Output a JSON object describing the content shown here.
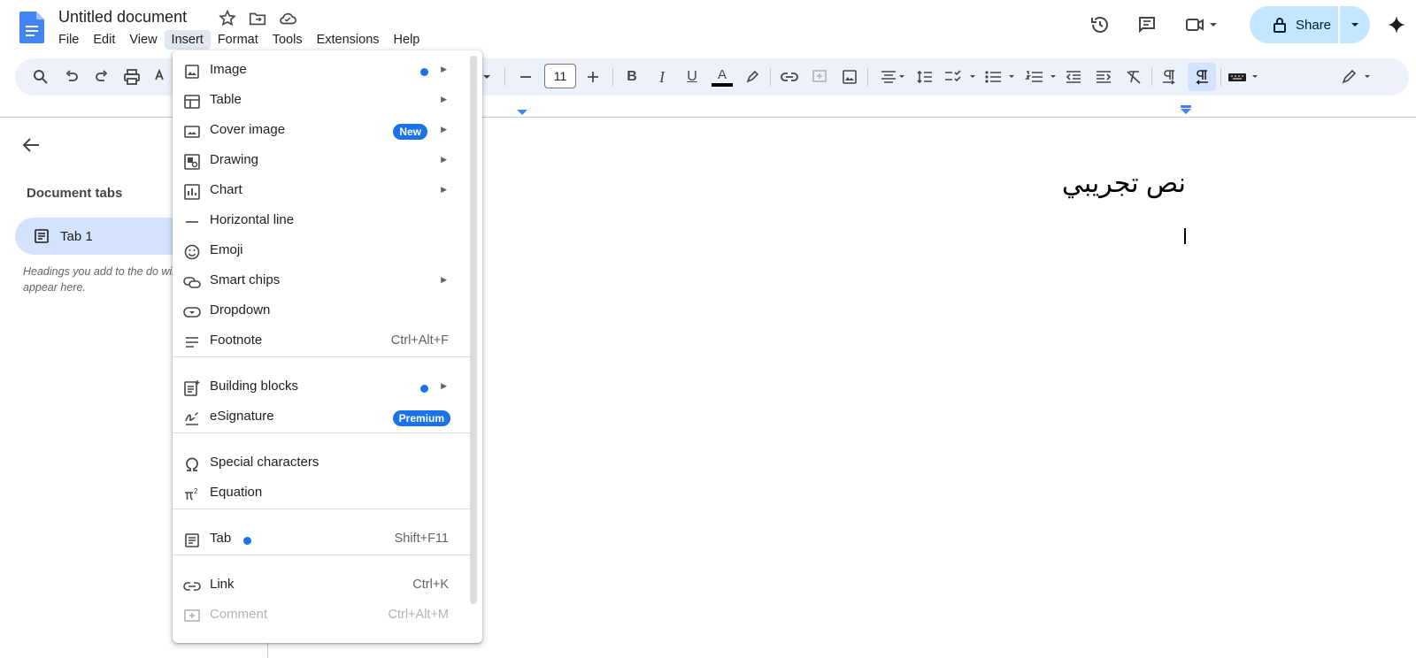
{
  "header": {
    "title": "Untitled document",
    "menus": [
      "File",
      "Edit",
      "View",
      "Insert",
      "Format",
      "Tools",
      "Extensions",
      "Help"
    ],
    "active_menu": "Insert",
    "share_label": "Share"
  },
  "toolbar": {
    "font_size": "11"
  },
  "sidebar": {
    "title": "Document tabs",
    "tab_label": "Tab 1",
    "hint": "Headings you add to the do will appear here."
  },
  "document": {
    "text": "نص تجريبي"
  },
  "insert_menu": {
    "items": [
      {
        "label": "Image",
        "icon": "image-icon",
        "submenu": true,
        "dot": true
      },
      {
        "label": "Table",
        "icon": "table-icon",
        "submenu": true
      },
      {
        "label": "Cover image",
        "icon": "cover-image-icon",
        "submenu": true,
        "badge": "New"
      },
      {
        "label": "Drawing",
        "icon": "drawing-icon",
        "submenu": true
      },
      {
        "label": "Chart",
        "icon": "chart-icon",
        "submenu": true
      },
      {
        "label": "Horizontal line",
        "icon": "horizontal-line-icon"
      },
      {
        "label": "Emoji",
        "icon": "emoji-icon"
      },
      {
        "label": "Smart chips",
        "icon": "smart-chips-icon",
        "submenu": true
      },
      {
        "label": "Dropdown",
        "icon": "dropdown-icon"
      },
      {
        "label": "Footnote",
        "icon": "footnote-icon",
        "shortcut": "Ctrl+Alt+F"
      },
      {
        "label": "Building blocks",
        "icon": "building-blocks-icon",
        "submenu": true,
        "dot": true
      },
      {
        "label": "eSignature",
        "icon": "esignature-icon",
        "badge": "Premium"
      },
      {
        "label": "Special characters",
        "icon": "omega-icon"
      },
      {
        "label": "Equation",
        "icon": "pi-icon"
      },
      {
        "label": "Tab",
        "icon": "tab-icon",
        "shortcut": "Shift+F11",
        "dot": true
      },
      {
        "label": "Link",
        "icon": "link-icon",
        "shortcut": "Ctrl+K"
      },
      {
        "label": "Comment",
        "icon": "comment-icon",
        "shortcut": "Ctrl+Alt+M",
        "disabled": true
      }
    ]
  },
  "colors": {
    "accent": "#1a73e8",
    "share_bg": "#c2e7ff",
    "toolbar_bg": "#edf2fa",
    "tab_selected_bg": "#d3e3fd"
  }
}
